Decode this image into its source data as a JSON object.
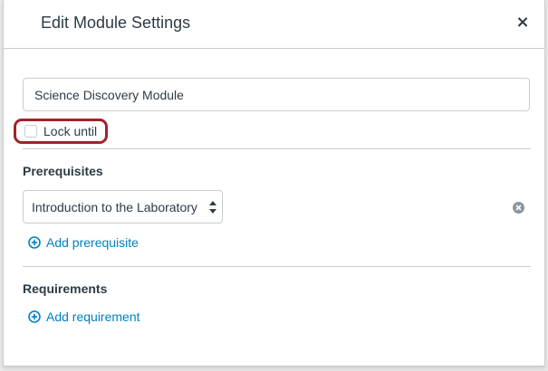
{
  "dialog": {
    "title": "Edit Module Settings",
    "close_label": "×"
  },
  "module": {
    "name_value": "Science Discovery Module"
  },
  "lock": {
    "label": "Lock until",
    "checked": false
  },
  "prerequisites": {
    "heading": "Prerequisites",
    "selected": "Introduction to the Laboratory",
    "add_label": "Add prerequisite",
    "remove_icon": "remove-circle-icon"
  },
  "requirements": {
    "heading": "Requirements",
    "add_label": "Add requirement"
  },
  "colors": {
    "accent": "#0081c1",
    "highlight": "#a0232a",
    "text": "#2d3b45",
    "border": "#c7cdd1"
  }
}
